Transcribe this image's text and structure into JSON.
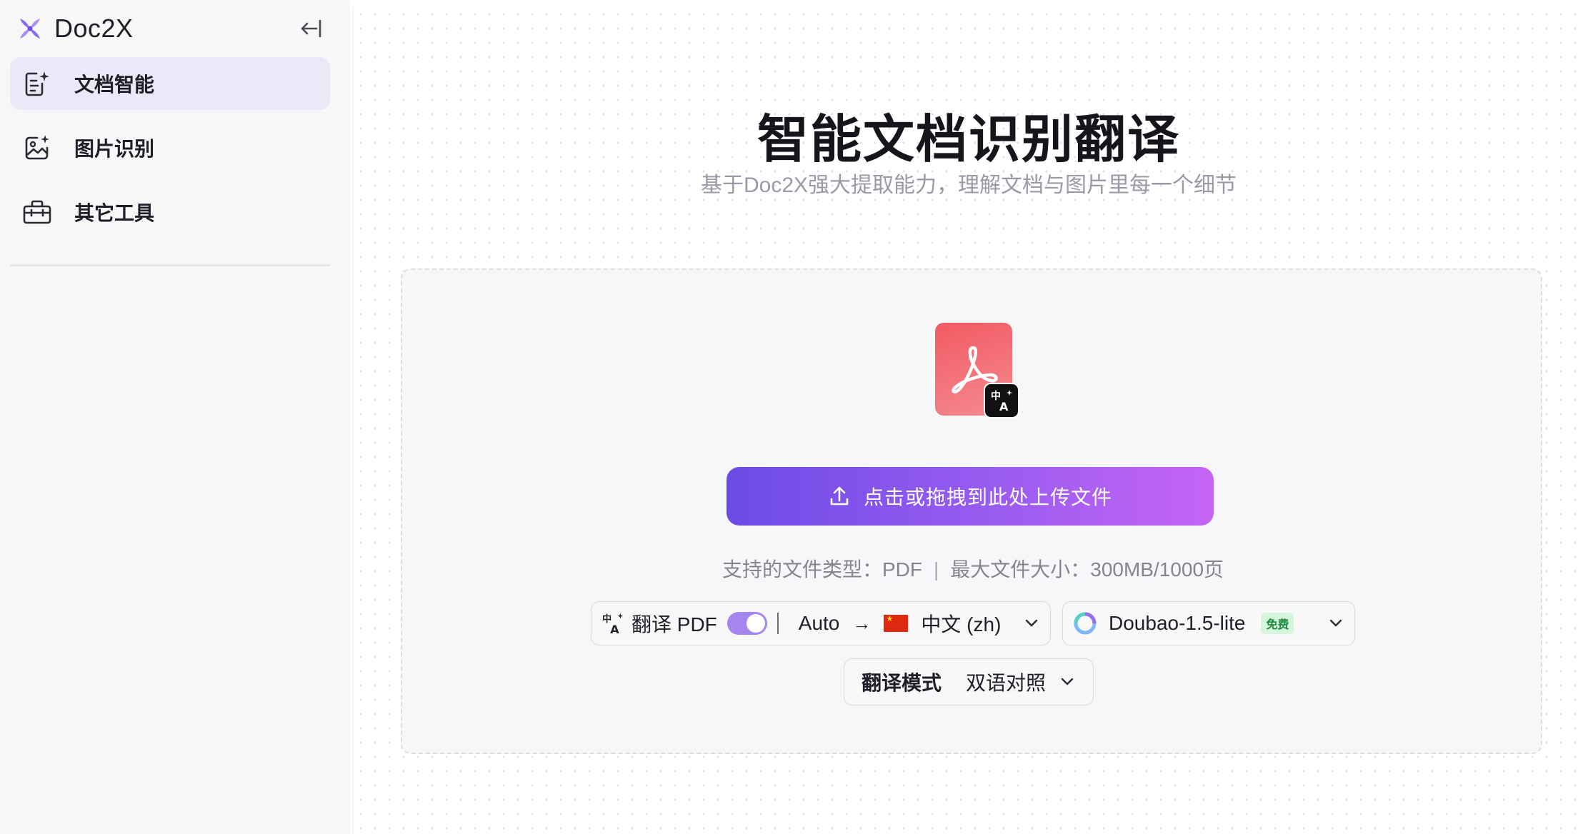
{
  "sidebar": {
    "brand": "Doc2X",
    "items": [
      {
        "label": "文档智能",
        "icon": "document-sparkle-icon",
        "active": true
      },
      {
        "label": "图片识别",
        "icon": "image-sparkle-icon",
        "active": false
      },
      {
        "label": "其它工具",
        "icon": "toolbox-icon",
        "active": false
      }
    ]
  },
  "main": {
    "title": "智能文档识别翻译",
    "subtitle": "基于Doc2X强大提取能力，理解文档与图片里每一个细节",
    "upload": {
      "button_label": "点击或拖拽到此处上传文件",
      "supported_types": "支持的文件类型：PDF",
      "separator": "|",
      "max_size": "最大文件大小：300MB/1000页"
    },
    "translate": {
      "label": "翻译 PDF",
      "enabled": true,
      "source_lang": "Auto",
      "target_lang": "中文 (zh)",
      "target_flag": "china-flag"
    },
    "model": {
      "name": "Doubao-1.5-lite",
      "badge": "免费"
    },
    "mode": {
      "label": "翻译模式",
      "value": "双语对照"
    }
  },
  "colors": {
    "accent_start": "#6b4be6",
    "accent_end": "#c564f4",
    "sidebar_active_bg": "#ebe9f8",
    "pdf_red": "#f25a63",
    "free_badge_bg": "#d6f5dd"
  }
}
